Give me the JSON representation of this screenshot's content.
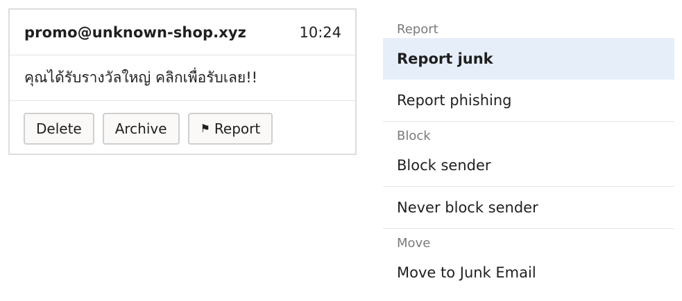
{
  "email": {
    "sender": "promo@unknown-shop.xyz",
    "time": "10:24",
    "subject": "คุณได้รับรางวัลใหญ่ คลิกเพื่อรับเลย!!",
    "actions": {
      "delete_label": "Delete",
      "archive_label": "Archive",
      "report_label": "Report",
      "report_icon": "flag-icon"
    }
  },
  "menu": {
    "groups": [
      {
        "label": "Report",
        "items": [
          {
            "label": "Report junk",
            "selected": true
          },
          {
            "label": "Report phishing",
            "selected": false
          }
        ]
      },
      {
        "label": "Block",
        "items": [
          {
            "label": "Block sender",
            "selected": false
          },
          {
            "label": "Never block sender",
            "selected": false
          }
        ]
      },
      {
        "label": "Move",
        "items": [
          {
            "label": "Move to Junk Email",
            "selected": false
          }
        ]
      }
    ]
  },
  "colors": {
    "selected_bg": "#e6eef9",
    "group_label": "#7a7a7a",
    "border": "#dcdcdc"
  }
}
